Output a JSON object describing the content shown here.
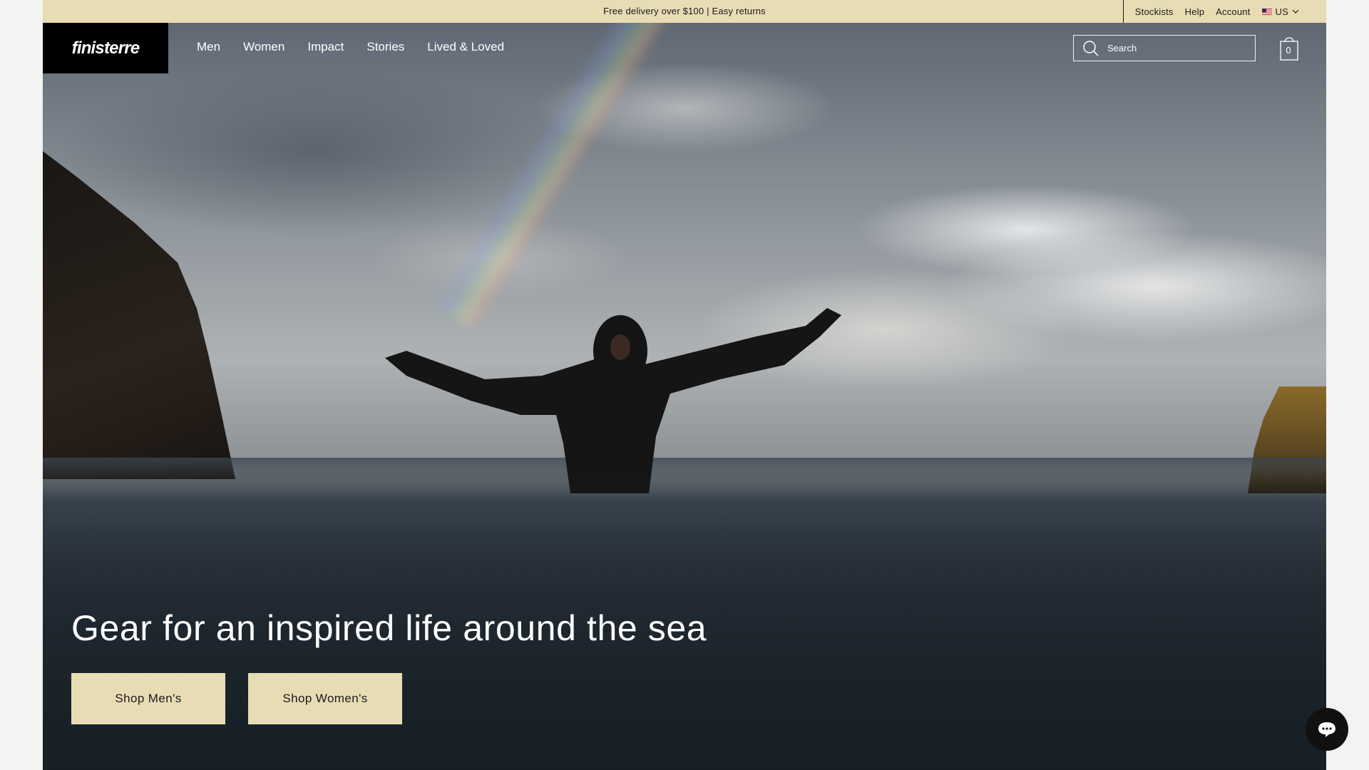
{
  "announcement": {
    "text": "Free delivery over $100 | Easy returns"
  },
  "utility_links": {
    "stockists": "Stockists",
    "help": "Help",
    "account": "Account",
    "locale": "US"
  },
  "header": {
    "logo": "finisterre",
    "nav": [
      "Men",
      "Women",
      "Impact",
      "Stories",
      "Lived & Loved"
    ],
    "search_placeholder": "Search",
    "cart_count": "0"
  },
  "hero": {
    "headline": "Gear for an inspired life around the sea",
    "cta_men": "Shop Men's",
    "cta_women": "Shop Women's"
  },
  "icons": {
    "search": "search-icon",
    "cart": "shopping-bag-icon",
    "chevron": "chevron-down-icon",
    "flag": "us-flag-icon",
    "chat": "chat-bubble-icon"
  },
  "colors": {
    "accent_sand": "#e8dcb5",
    "logo_bg": "#000000",
    "text_dark": "#1a1a1a"
  }
}
